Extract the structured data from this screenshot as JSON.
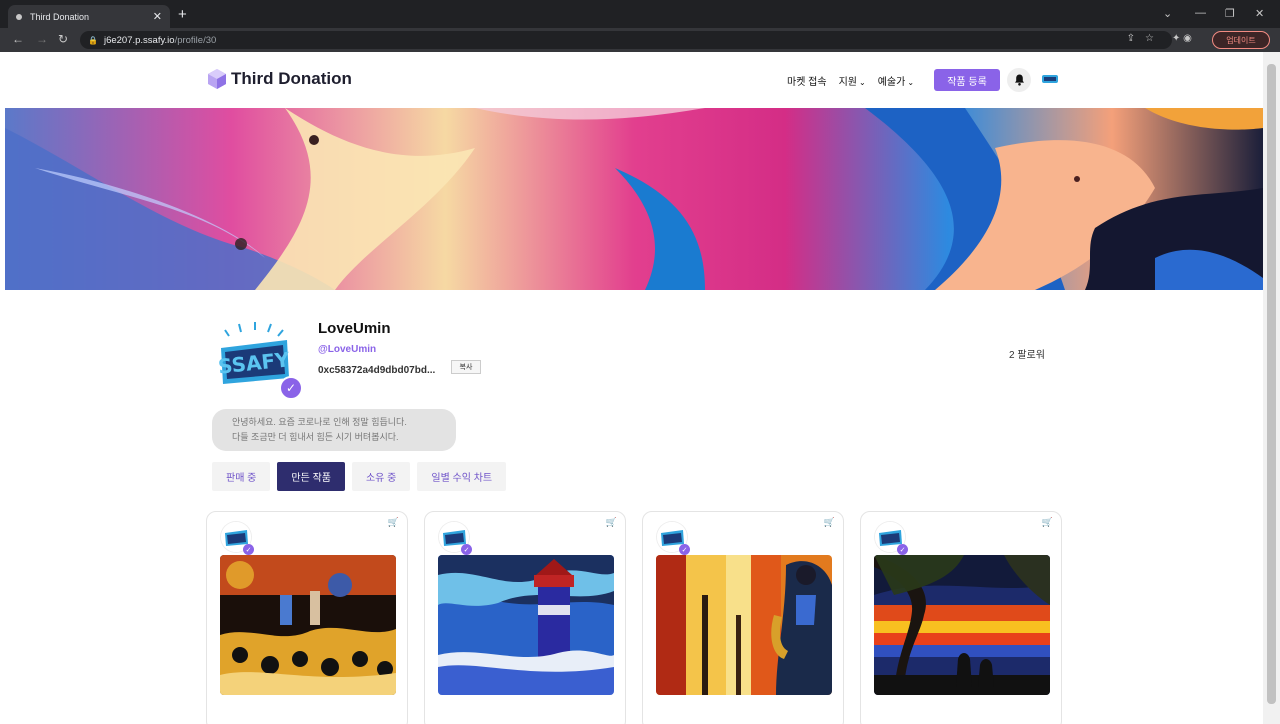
{
  "browser": {
    "tab_title": "Third Donation",
    "url_host": "j6e207.p.ssafy.io",
    "url_path": "/profile/30",
    "update_label": "업데이트"
  },
  "header": {
    "logo_text": "Third Donation",
    "nav": [
      {
        "label": "마켓 접속",
        "has_dropdown": false
      },
      {
        "label": "지원",
        "has_dropdown": true
      },
      {
        "label": "예술가",
        "has_dropdown": true
      }
    ],
    "register_label": "작품 등록"
  },
  "profile": {
    "name": "LoveUmin",
    "handle": "@LoveUmin",
    "wallet": "0xc58372a4d9dbd07bd...",
    "copy_label": "복사",
    "followers": "2 팔로워",
    "bio_line1": "안녕하세요. 요즘 코로나로 인해 정말 힘듭니다.",
    "bio_line2": "다들 조금만 더 힘내서 힘든 시기 버텨봅시다."
  },
  "tabs": [
    {
      "label": "판매 중",
      "active": false
    },
    {
      "label": "만든 작품",
      "active": true
    },
    {
      "label": "소유 중",
      "active": false
    },
    {
      "label": "일별 수익 차트",
      "active": false
    }
  ],
  "cards": [
    {
      "art": "concert-painting"
    },
    {
      "art": "lighthouse-painting"
    },
    {
      "art": "saxophone-painting"
    },
    {
      "art": "sunset-dogs-painting"
    }
  ],
  "colors": {
    "accent": "#8a63e8",
    "active_tab": "#2e2d6e"
  }
}
